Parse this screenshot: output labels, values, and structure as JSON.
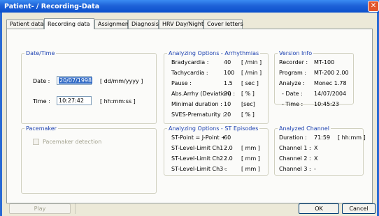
{
  "window": {
    "title": "Patient- / Recording-Data",
    "close_icon": "close-icon"
  },
  "tabs": [
    {
      "label": "Patient data",
      "active": false
    },
    {
      "label": "Recording data",
      "active": true
    },
    {
      "label": "Assignment",
      "active": false
    },
    {
      "label": "Diagnosis",
      "active": false
    },
    {
      "label": "HRV Day/Night",
      "active": false
    },
    {
      "label": "Cover letters",
      "active": false
    }
  ],
  "datetime": {
    "legend": "Date/Time",
    "date_label": "Date :",
    "date_value": "20/07/1998",
    "date_format": "[ dd/mm/yyyy ]",
    "time_label": "Time :",
    "time_value": "10:27:42",
    "time_format": "[ hh:mm:ss ]"
  },
  "pacemaker": {
    "legend": "Pacemaker",
    "checkbox_label": "Pacemaker detection",
    "checked": false
  },
  "arrhythmias": {
    "legend": "Analyzing Options - Arrhythmias",
    "rows": [
      {
        "label": "Bradycardia :",
        "value": "40",
        "unit": "[ /min ]"
      },
      {
        "label": "Tachycardia :",
        "value": "100",
        "unit": "[ /min ]"
      },
      {
        "label": "Pause :",
        "value": "1.5",
        "unit": "[ sec ]"
      },
      {
        "label": "Abs.Arrhy (Deviation) :",
        "value": "20",
        "unit": "[ % ]"
      },
      {
        "label": "Minimal duration :",
        "value": "10",
        "unit": "[sec]"
      },
      {
        "label": "SVES-Prematurity :",
        "value": "20",
        "unit": "[ % ]"
      }
    ]
  },
  "st_episodes": {
    "legend": "Analyzing Options - ST Episodes",
    "rows": [
      {
        "label": "ST-Point = J-Point +",
        "value": "60",
        "unit": ""
      },
      {
        "label": "ST-Level-Limit Ch1 :",
        "value": "2.0",
        "unit": "[ mm ]"
      },
      {
        "label": "ST-Level-Limit Ch2 :",
        "value": "2.0",
        "unit": "[ mm ]"
      },
      {
        "label": "ST-Level-Limit Ch3 :",
        "value": "-",
        "unit": "[ mm ]"
      }
    ]
  },
  "version_info": {
    "legend": "Version Info",
    "rows": [
      {
        "label": "Recorder :",
        "value": "MT-100"
      },
      {
        "label": "Program :",
        "value": "MT-200 2.00"
      },
      {
        "label": "Analyze :",
        "value": "Monec 1.78"
      },
      {
        "label": "- Date :",
        "value": "14/07/2004"
      },
      {
        "label": "- Time :",
        "value": "10:45:23"
      }
    ]
  },
  "analyzed_channel": {
    "legend": "Analyzed Channel",
    "duration_label": "Duration :",
    "duration_value": "71:59",
    "duration_unit": "[ hh:mm ]",
    "rows": [
      {
        "label": "Channel 1 :",
        "value": "X"
      },
      {
        "label": "Channel 2 :",
        "value": "X"
      },
      {
        "label": "Channel 3 :",
        "value": "-"
      }
    ]
  },
  "buttons": {
    "play": "Play",
    "ok": "OK",
    "cancel": "Cancel"
  },
  "colors": {
    "titlebar": "#1f63d8",
    "legend_text": "#1a3fb0",
    "selection": "#316ac5",
    "window_bg": "#ece9d8"
  }
}
